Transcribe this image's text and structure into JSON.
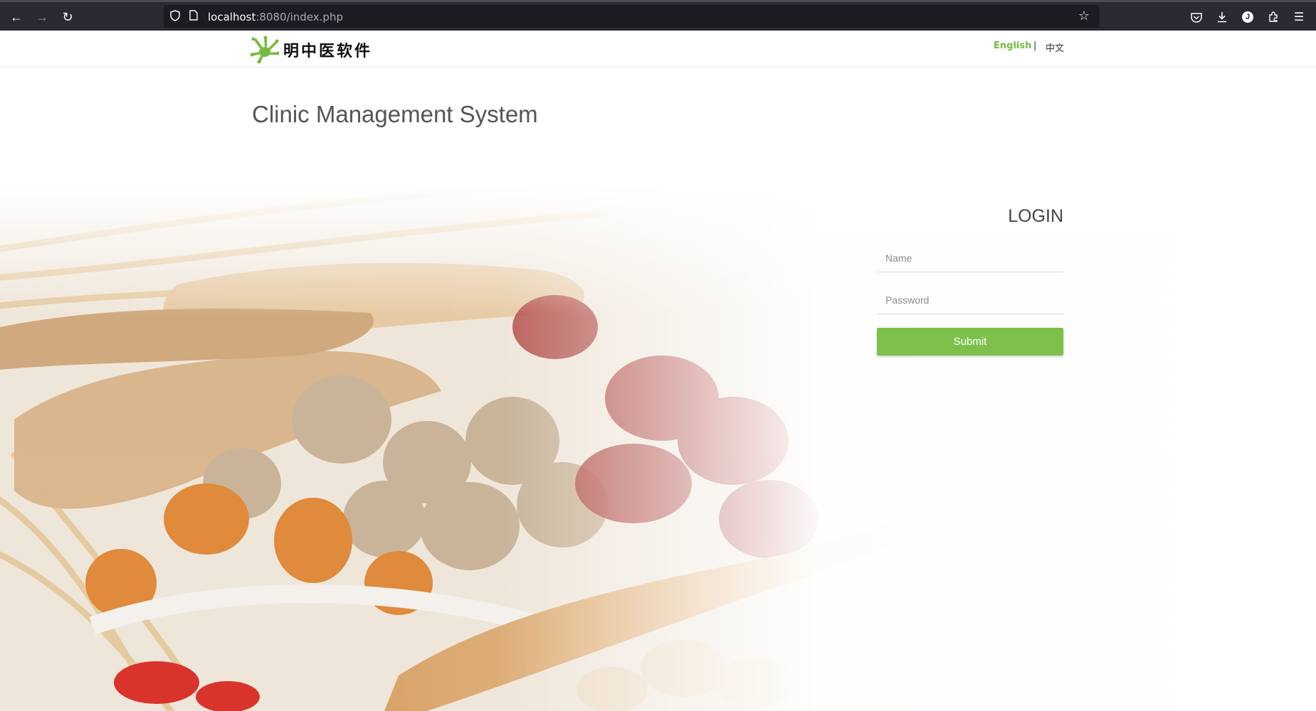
{
  "browser": {
    "url_host": "localhost",
    "url_rest": ":8080/index.php"
  },
  "header": {
    "logo_text": "明中医软件",
    "lang_english": "English",
    "lang_separator": "|",
    "lang_chinese": "中文"
  },
  "main": {
    "title": "Clinic Management System"
  },
  "login": {
    "heading": "LOGIN",
    "name_placeholder": "Name",
    "password_placeholder": "Password",
    "submit_label": "Submit"
  },
  "colors": {
    "accent_green": "#7dc14a",
    "browser_bar": "#2b2a33"
  }
}
